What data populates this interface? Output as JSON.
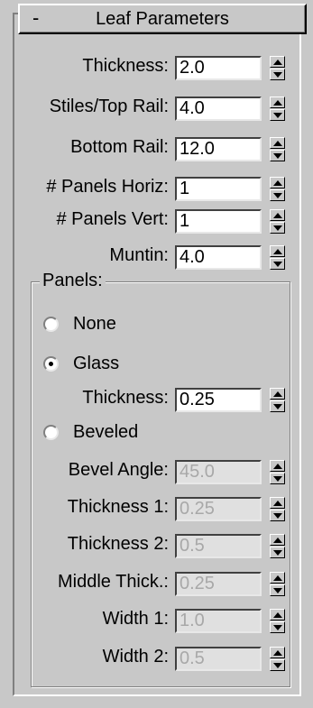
{
  "rollout": {
    "collapse_sign": "-",
    "title": "Leaf Parameters"
  },
  "params": [
    {
      "label": "Thickness:",
      "value": "2.0",
      "enabled": true
    },
    {
      "label": "Stiles/Top Rail:",
      "value": "4.0",
      "enabled": true
    },
    {
      "label": "Bottom Rail:",
      "value": "12.0",
      "enabled": true
    },
    {
      "label": "# Panels Horiz:",
      "value": "1",
      "enabled": true
    },
    {
      "label": "# Panels Vert:",
      "value": "1",
      "enabled": true
    },
    {
      "label": "Muntin:",
      "value": "4.0",
      "enabled": true
    }
  ],
  "panels": {
    "group_title": "Panels:",
    "options": [
      {
        "label": "None",
        "selected": false
      },
      {
        "label": "Glass",
        "selected": true
      },
      {
        "label": "Beveled",
        "selected": false
      }
    ],
    "glass_thickness": {
      "label": "Thickness:",
      "value": "0.25",
      "enabled": true
    },
    "beveled_params": [
      {
        "label": "Bevel Angle:",
        "value": "45.0",
        "enabled": false
      },
      {
        "label": "Thickness 1:",
        "value": "0.25",
        "enabled": false
      },
      {
        "label": "Thickness 2:",
        "value": "0.5",
        "enabled": false
      },
      {
        "label": "Middle Thick.:",
        "value": "0.25",
        "enabled": false
      },
      {
        "label": "Width 1:",
        "value": "1.0",
        "enabled": false
      },
      {
        "label": "Width 2:",
        "value": "0.5",
        "enabled": false
      }
    ]
  }
}
